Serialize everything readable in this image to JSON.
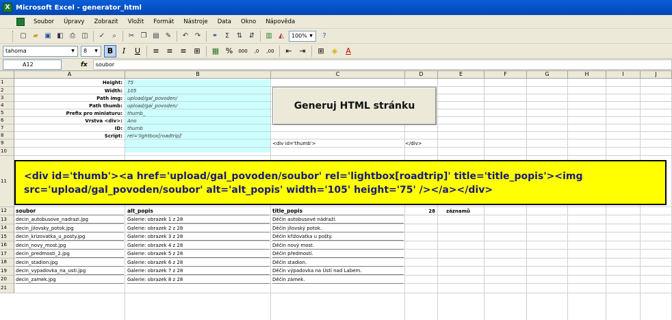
{
  "window": {
    "title": "Microsoft Excel - generator_html"
  },
  "menu": [
    "Soubor",
    "Úpravy",
    "Zobrazit",
    "Vložit",
    "Formát",
    "Nástroje",
    "Data",
    "Okno",
    "Nápověda"
  ],
  "toolbar": {
    "zoom": "100%"
  },
  "format": {
    "font": "tahoma",
    "size": "8"
  },
  "formula": {
    "cell_ref": "A12",
    "value": "soubor"
  },
  "columns": [
    "A",
    "B",
    "C",
    "D",
    "E",
    "F",
    "G",
    "H",
    "I",
    "J"
  ],
  "settings": [
    {
      "label": "Height:",
      "value": "75"
    },
    {
      "label": "Width:",
      "value": "105"
    },
    {
      "label": "Path img:",
      "value": "upload/gal_povoden/"
    },
    {
      "label": "Path thumb:",
      "value": "upload/gal_povoden/"
    },
    {
      "label": "Prefix pro miniaturu:",
      "value": "thumb_"
    },
    {
      "label": "Vrstva <div>:",
      "value": "Ano"
    },
    {
      "label": "ID:",
      "value": "thumb"
    },
    {
      "label": "Script:",
      "value": "rel='lightbox[roadtrip]'"
    }
  ],
  "generate_button": "Generuj HTML stránku",
  "div_open": "<div id='thumb'>",
  "div_close": "</div>",
  "output": "<div id='thumb'><a  href='upload/gal_povoden/soubor' rel='lightbox[roadtrip]' title='title_popis'><img src='upload/gal_povoden/soubor' alt='alt_popis' width='105' height='75' /></a></div>",
  "table": {
    "headers": [
      "soubor",
      "alt_popis",
      "title_popis"
    ],
    "count": "28",
    "count_label": "záznamů",
    "rows": [
      {
        "n": "13",
        "file": "decin_autobusove_nadrazi.jpg",
        "alt": "Galerie: obrazek 1 z 28",
        "title": "Děčín autobusové nádraží."
      },
      {
        "n": "14",
        "file": "decin_jilovsky_potok.jpg",
        "alt": "Galerie: obrazek 2 z 28",
        "title": "Děčín jílovský potok."
      },
      {
        "n": "15",
        "file": "decin_krizovatka_u_posty.jpg",
        "alt": "Galerie: obrazek 3 z 28",
        "title": "Děčín křižovatka u pošty."
      },
      {
        "n": "16",
        "file": "decin_novy_most.jpg",
        "alt": "Galerie: obrazek 4 z 28",
        "title": "Děčín nový most."
      },
      {
        "n": "17",
        "file": "decin_predmosti_2.jpg",
        "alt": "Galerie: obrazek 5 z 28",
        "title": "Děčín předmostí."
      },
      {
        "n": "18",
        "file": "decin_stadion.jpg",
        "alt": "Galerie: obrazek 6 z 28",
        "title": "Děčín stadion."
      },
      {
        "n": "19",
        "file": "decin_vypadovka_na_usti.jpg",
        "alt": "Galerie: obrazek 7 z 28",
        "title": "Děčín výpadovka na Ústí nad Labem."
      },
      {
        "n": "20",
        "file": "decin_zamek.jpg",
        "alt": "Galerie: obrazek 8 z 28",
        "title": "Děčín zámek."
      }
    ]
  }
}
